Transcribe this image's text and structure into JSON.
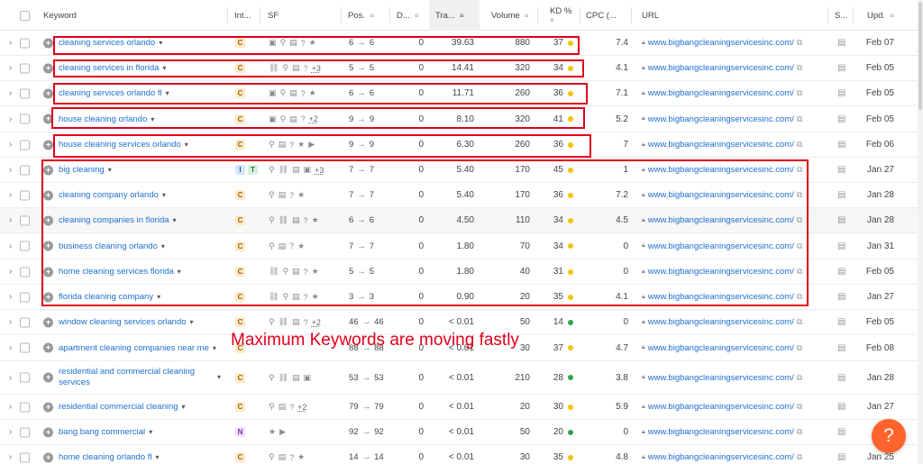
{
  "columns": {
    "keyword": "Keyword",
    "intent": "Int...",
    "sf": "SF",
    "position": "Pos.",
    "difference": "D...",
    "traffic": "Tra...",
    "volume": "Volume",
    "kd": "KD %",
    "cpc": "CPC (...",
    "url": "URL",
    "serp": "S...",
    "updated": "Upd."
  },
  "rows": [
    {
      "keyword": "cleaning services orlando",
      "intents": [
        "C"
      ],
      "sf": [
        "img",
        "pin",
        "doc",
        "q",
        "star"
      ],
      "sf_more": "",
      "pos_from": "6",
      "pos_to": "6",
      "diff": "0",
      "traffic": "39.63",
      "volume": "880",
      "kd": "37",
      "kd_color": "#f5c400",
      "cpc": "7.4",
      "url": "www.bigbangcleaningservicesinc.com/",
      "updated": "Feb 07"
    },
    {
      "keyword": "cleaning services in florida",
      "intents": [
        "C"
      ],
      "sf": [
        "link",
        "pin",
        "doc",
        "q"
      ],
      "sf_more": "+3",
      "pos_from": "5",
      "pos_to": "5",
      "diff": "0",
      "traffic": "14.41",
      "volume": "320",
      "kd": "34",
      "kd_color": "#f5c400",
      "cpc": "4.1",
      "url": "www.bigbangcleaningservicesinc.com/",
      "updated": "Feb 05"
    },
    {
      "keyword": "cleaning services orlando fl",
      "intents": [
        "C"
      ],
      "sf": [
        "img",
        "pin",
        "doc",
        "q",
        "star"
      ],
      "sf_more": "",
      "pos_from": "6",
      "pos_to": "6",
      "diff": "0",
      "traffic": "11.71",
      "volume": "260",
      "kd": "36",
      "kd_color": "#f5c400",
      "cpc": "7.1",
      "url": "www.bigbangcleaningservicesinc.com/",
      "updated": "Feb 05"
    },
    {
      "keyword": "house cleaning orlando",
      "intents": [
        "C"
      ],
      "sf": [
        "img",
        "pin",
        "doc",
        "q"
      ],
      "sf_more": "+2",
      "pos_from": "9",
      "pos_to": "9",
      "diff": "0",
      "traffic": "8.10",
      "volume": "320",
      "kd": "41",
      "kd_color": "#f5c400",
      "cpc": "5.2",
      "url": "www.bigbangcleaningservicesinc.com/",
      "updated": "Feb 05"
    },
    {
      "keyword": "house cleaning services orlando",
      "intents": [
        "C"
      ],
      "sf": [
        "pin",
        "doc",
        "q",
        "star",
        "play"
      ],
      "sf_more": "",
      "pos_from": "9",
      "pos_to": "9",
      "diff": "0",
      "traffic": "6.30",
      "volume": "260",
      "kd": "36",
      "kd_color": "#f5c400",
      "cpc": "7",
      "url": "www.bigbangcleaningservicesinc.com/",
      "updated": "Feb 06"
    },
    {
      "keyword": "big cleaning",
      "intents": [
        "I",
        "T"
      ],
      "sf": [
        "pin",
        "link",
        "doc",
        "img"
      ],
      "sf_more": "+3",
      "pos_from": "7",
      "pos_to": "7",
      "diff": "0",
      "traffic": "5.40",
      "volume": "170",
      "kd": "45",
      "kd_color": "#f5c400",
      "cpc": "1",
      "url": "www.bigbangcleaningservicesinc.com/",
      "updated": "Jan 27"
    },
    {
      "keyword": "cleaning company orlando",
      "intents": [
        "C"
      ],
      "sf": [
        "pin",
        "doc",
        "q",
        "star"
      ],
      "sf_more": "",
      "pos_from": "7",
      "pos_to": "7",
      "diff": "0",
      "traffic": "5.40",
      "volume": "170",
      "kd": "36",
      "kd_color": "#f5c400",
      "cpc": "7.2",
      "url": "www.bigbangcleaningservicesinc.com/",
      "updated": "Jan 28"
    },
    {
      "keyword": "cleaning companies in florida",
      "intents": [
        "C"
      ],
      "sf": [
        "pin",
        "link",
        "doc",
        "q",
        "star"
      ],
      "sf_more": "",
      "pos_from": "6",
      "pos_to": "6",
      "diff": "0",
      "traffic": "4.50",
      "volume": "110",
      "kd": "34",
      "kd_color": "#f5c400",
      "cpc": "4.5",
      "url": "www.bigbangcleaningservicesinc.com/",
      "updated": "Jan 28"
    },
    {
      "keyword": "business cleaning orlando",
      "intents": [
        "C"
      ],
      "sf": [
        "pin",
        "doc",
        "q",
        "star"
      ],
      "sf_more": "",
      "pos_from": "7",
      "pos_to": "7",
      "diff": "0",
      "traffic": "1.80",
      "volume": "70",
      "kd": "34",
      "kd_color": "#f5c400",
      "cpc": "0",
      "url": "www.bigbangcleaningservicesinc.com/",
      "updated": "Jan 31"
    },
    {
      "keyword": "home cleaning services florida",
      "intents": [
        "C"
      ],
      "sf": [
        "link",
        "pin",
        "doc",
        "q",
        "star"
      ],
      "sf_more": "",
      "pos_from": "5",
      "pos_to": "5",
      "diff": "0",
      "traffic": "1.80",
      "volume": "40",
      "kd": "31",
      "kd_color": "#f5c400",
      "cpc": "0",
      "url": "www.bigbangcleaningservicesinc.com/",
      "updated": "Feb 05"
    },
    {
      "keyword": "florida cleaning company",
      "intents": [
        "C"
      ],
      "sf": [
        "link",
        "pin",
        "doc",
        "q",
        "star"
      ],
      "sf_more": "",
      "pos_from": "3",
      "pos_to": "3",
      "diff": "0",
      "traffic": "0.90",
      "volume": "20",
      "kd": "35",
      "kd_color": "#f5c400",
      "cpc": "4.1",
      "url": "www.bigbangcleaningservicesinc.com/",
      "updated": "Jan 27"
    },
    {
      "keyword": "window cleaning services orlando",
      "intents": [
        "C"
      ],
      "sf": [
        "pin",
        "link",
        "doc",
        "q"
      ],
      "sf_more": "+2",
      "pos_from": "46",
      "pos_to": "46",
      "diff": "0",
      "traffic": "< 0.01",
      "volume": "50",
      "kd": "14",
      "kd_color": "#2fa34a",
      "cpc": "0",
      "url": "www.bigbangcleaningservicesinc.com/",
      "updated": "Feb 05"
    },
    {
      "keyword": "apartment cleaning companies near me",
      "intents": [
        "C"
      ],
      "sf": [],
      "sf_more": "",
      "pos_from": "88",
      "pos_to": "88",
      "diff": "0",
      "traffic": "< 0.01",
      "volume": "30",
      "kd": "37",
      "kd_color": "#f5c400",
      "cpc": "4.7",
      "url": "www.bigbangcleaningservicesinc.com/",
      "updated": "Feb 08"
    },
    {
      "keyword": "residential and commercial cleaning services",
      "intents": [
        "C"
      ],
      "sf": [
        "pin",
        "link",
        "doc",
        "img"
      ],
      "sf_more": "",
      "pos_from": "53",
      "pos_to": "53",
      "diff": "0",
      "traffic": "< 0.01",
      "volume": "210",
      "kd": "28",
      "kd_color": "#2fa34a",
      "cpc": "3.8",
      "url": "www.bigbangcleaningservicesinc.com/",
      "updated": "Jan 28"
    },
    {
      "keyword": "residential commercial cleaning",
      "intents": [
        "C"
      ],
      "sf": [
        "pin",
        "doc",
        "q"
      ],
      "sf_more": "+2",
      "pos_from": "79",
      "pos_to": "79",
      "diff": "0",
      "traffic": "< 0.01",
      "volume": "20",
      "kd": "30",
      "kd_color": "#f5c400",
      "cpc": "5.9",
      "url": "www.bigbangcleaningservicesinc.com/",
      "updated": "Jan 27"
    },
    {
      "keyword": "bang bang commercial",
      "intents": [
        "N"
      ],
      "sf": [
        "star",
        "play"
      ],
      "sf_more": "",
      "pos_from": "92",
      "pos_to": "92",
      "diff": "0",
      "traffic": "< 0.01",
      "volume": "50",
      "kd": "20",
      "kd_color": "#2fa34a",
      "cpc": "0",
      "url": "www.bigbangcleaningservicesinc.com/",
      "updated": "Jan"
    },
    {
      "keyword": "home cleaning orlando fl",
      "intents": [
        "C"
      ],
      "sf": [
        "pin",
        "doc",
        "q",
        "star"
      ],
      "sf_more": "",
      "pos_from": "14",
      "pos_to": "14",
      "diff": "0",
      "traffic": "< 0.01",
      "volume": "30",
      "kd": "35",
      "kd_color": "#f5c400",
      "cpc": "4.8",
      "url": "www.bigbangcleaningservicesinc.com/",
      "updated": "Jan 25"
    }
  ],
  "annotation": "Maximum Keywords are moving fastly",
  "help_label": "?",
  "annotation_color": "#e0001a",
  "link_color": "#1f6fd1"
}
